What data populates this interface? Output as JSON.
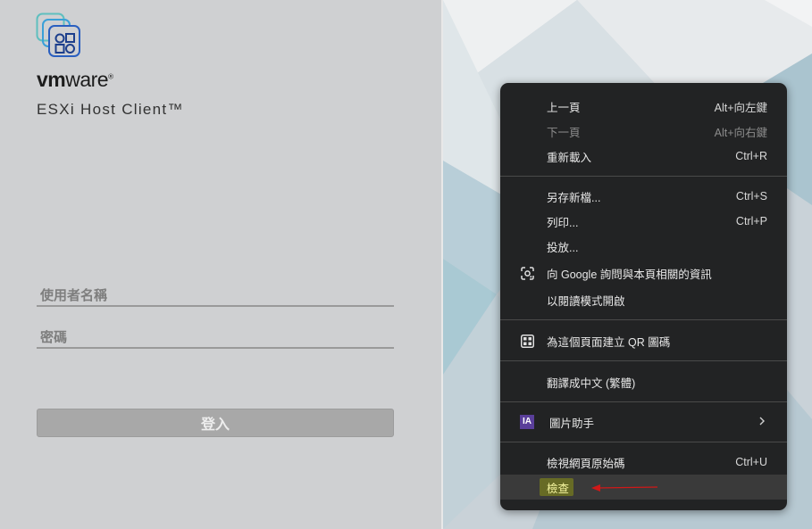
{
  "login": {
    "brand_bold": "vm",
    "brand_light": "ware",
    "brand_mark": "®",
    "product": "ESXi Host Client™",
    "username_placeholder": "使用者名稱",
    "password_placeholder": "密碼",
    "login_label": "登入"
  },
  "context_menu": {
    "back": {
      "label": "上一頁",
      "shortcut": "Alt+向左鍵"
    },
    "forward": {
      "label": "下一頁",
      "shortcut": "Alt+向右鍵"
    },
    "reload": {
      "label": "重新載入",
      "shortcut": "Ctrl+R"
    },
    "save_as": {
      "label": "另存新檔...",
      "shortcut": "Ctrl+S"
    },
    "print": {
      "label": "列印...",
      "shortcut": "Ctrl+P"
    },
    "cast": {
      "label": "投放..."
    },
    "search_google": {
      "label": "向 Google 詢問與本頁相關的資訊"
    },
    "reading_mode": {
      "label": "以閱讀模式開啟"
    },
    "qr_code": {
      "label": "為這個頁面建立 QR 圖碼"
    },
    "translate": {
      "label": "翻譯成中文 (繁體)"
    },
    "image_assistant": {
      "label": "圖片助手",
      "icon_text": "IA"
    },
    "view_source": {
      "label": "檢視網頁原始碼",
      "shortcut": "Ctrl+U"
    },
    "inspect": {
      "label": "檢查"
    }
  },
  "colors": {
    "menu_bg": "#222324",
    "arrow": "#d01818",
    "highlight": "#c4c800"
  }
}
